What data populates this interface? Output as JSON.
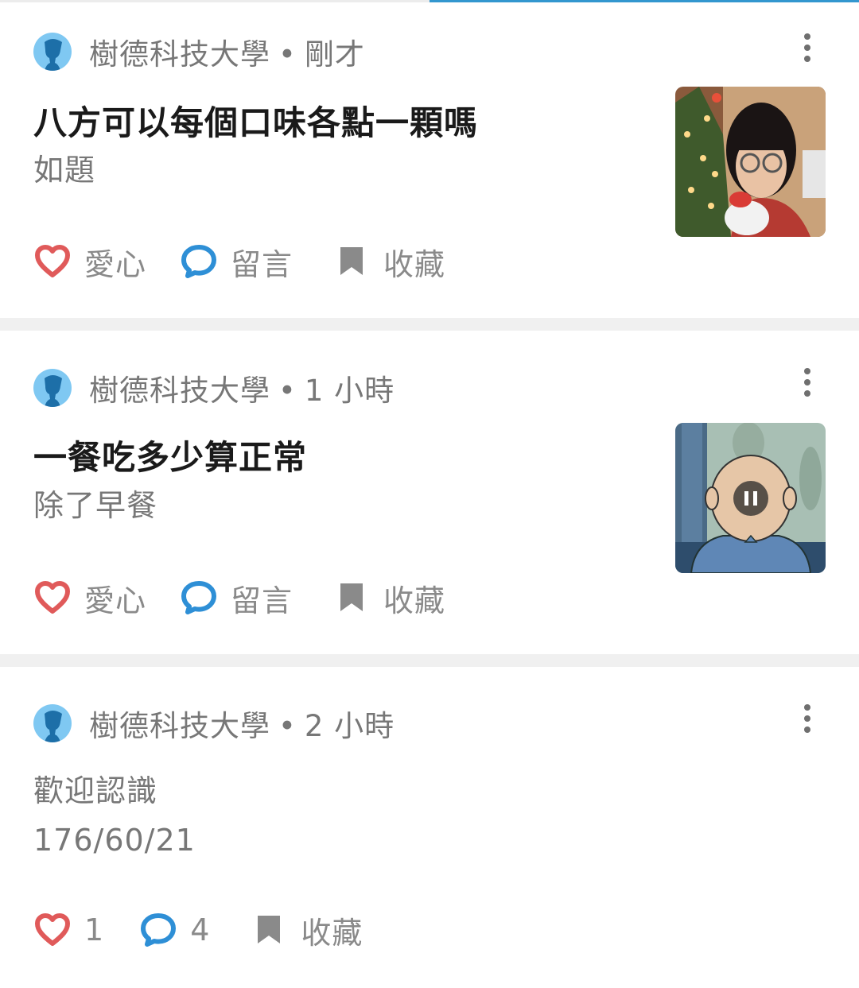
{
  "posts": [
    {
      "school": "樹德科技大學",
      "time": "剛才",
      "title": "八方可以每個口味各點一顆嗎",
      "excerpt": "如題",
      "like_label": "愛心",
      "comment_label": "留言",
      "save_label": "收藏",
      "has_thumbnail": true,
      "thumbnail": "photo of a girl with glasses in front of a christmas tree"
    },
    {
      "school": "樹德科技大學",
      "time": "1 小時",
      "title": "一餐吃多少算正常",
      "excerpt": "除了早餐",
      "like_label": "愛心",
      "comment_label": "留言",
      "save_label": "收藏",
      "has_thumbnail": true,
      "thumbnail": "cartoon character video frame with pause icon"
    },
    {
      "school": "樹德科技大學",
      "time": "2 小時",
      "title": "",
      "excerpt_lines": [
        "歡迎認識",
        "176/60/21"
      ],
      "like_label": "1",
      "comment_label": "4",
      "save_label": "收藏",
      "has_thumbnail": false
    }
  ],
  "colors": {
    "heart": "#e05a5a",
    "comment": "#2e8fd6",
    "bookmark": "#8a8a8a",
    "avatar": "#7fc8f2",
    "accent": "#3397cf"
  },
  "icons": {
    "avatar": "person-silhouette-icon",
    "like": "heart-icon",
    "comment": "speech-bubble-icon",
    "save": "bookmark-icon",
    "more": "more-vertical-icon",
    "pause": "pause-icon"
  }
}
